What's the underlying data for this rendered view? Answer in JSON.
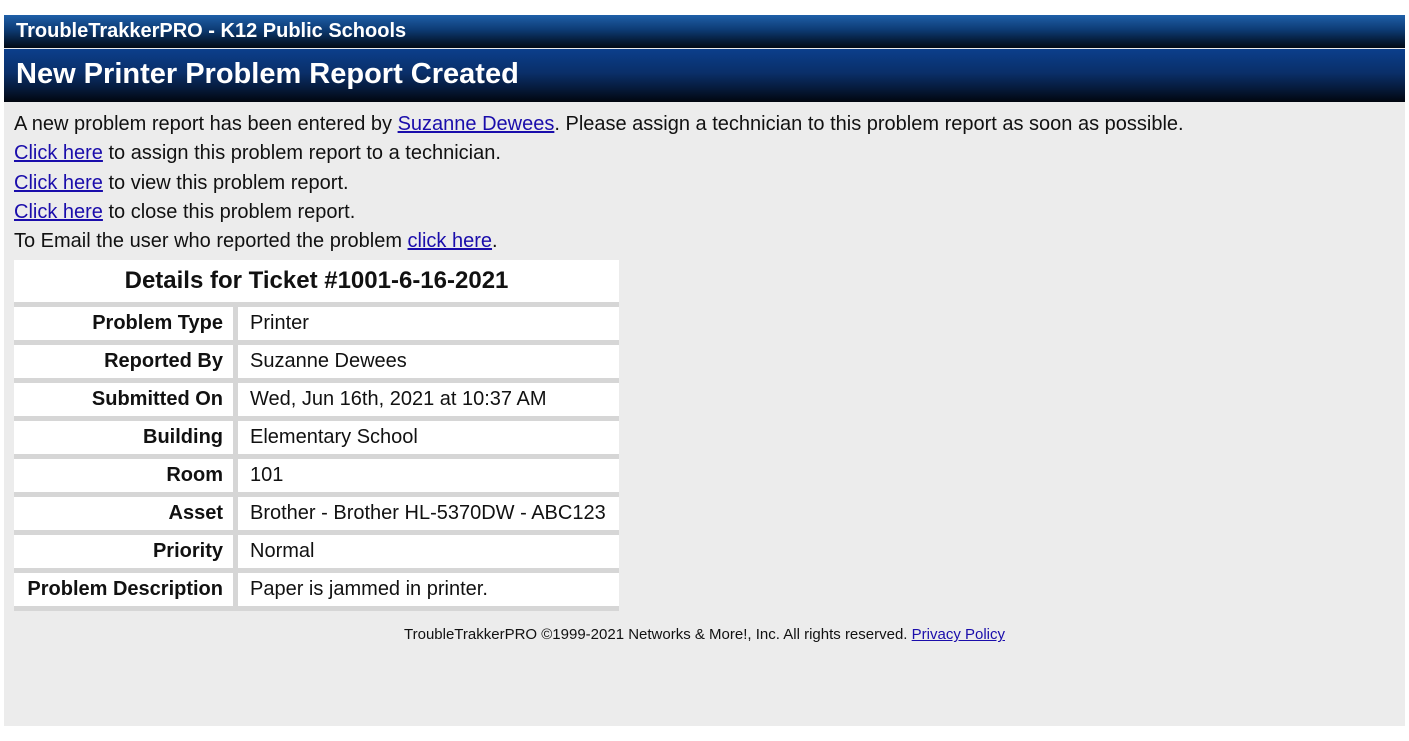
{
  "header": {
    "brand": "TroubleTrakkerPRO - K12 Public Schools",
    "title": "New Printer Problem Report Created"
  },
  "intro": {
    "prefix": "A new problem report has been entered by ",
    "reporter_link": "Suzanne Dewees",
    "suffix": ". Please assign a technician to this problem report as soon as possible."
  },
  "actions": [
    {
      "link": "Click here",
      "text": " to assign this problem report to a technician."
    },
    {
      "link": "Click here",
      "text": " to view this problem report."
    },
    {
      "link": "Click here",
      "text": " to close this problem report."
    }
  ],
  "email": {
    "prefix": "To Email the user who reported the problem ",
    "link": "click here",
    "suffix": "."
  },
  "ticket": {
    "caption": "Details for Ticket #1001-6-16-2021",
    "rows": [
      {
        "label": "Problem Type",
        "value": "Printer"
      },
      {
        "label": "Reported By",
        "value": "Suzanne Dewees"
      },
      {
        "label": "Submitted On",
        "value": "Wed, Jun 16th, 2021 at 10:37 AM"
      },
      {
        "label": "Building",
        "value": "Elementary School"
      },
      {
        "label": "Room",
        "value": "101"
      },
      {
        "label": "Asset",
        "value": "Brother - Brother HL-5370DW - ABC123"
      },
      {
        "label": "Priority",
        "value": "Normal"
      },
      {
        "label": "Problem Description",
        "value": "Paper is jammed in printer."
      }
    ]
  },
  "footer": {
    "copyright": "TroubleTrakkerPRO ©1999-2021 Networks & More!, Inc. All rights reserved. ",
    "privacy_link": "Privacy Policy"
  }
}
